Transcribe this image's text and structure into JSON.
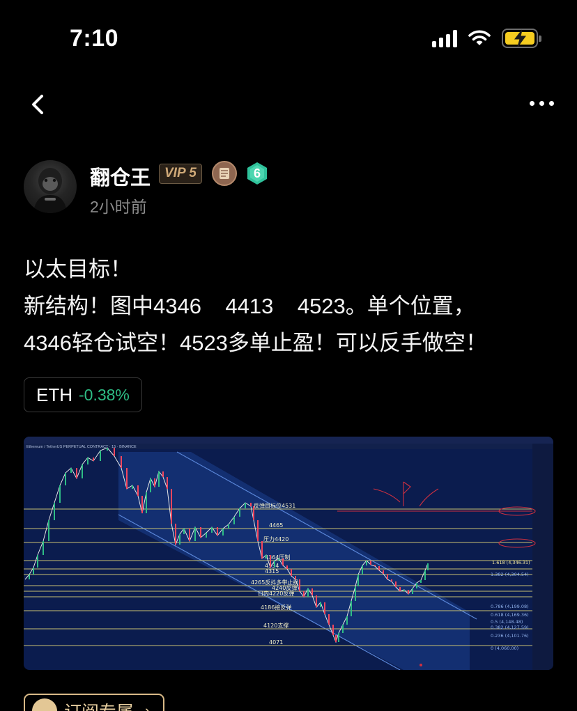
{
  "status_bar": {
    "time": "7:10"
  },
  "author": {
    "name": "翻仓王",
    "vip_label": "VIP 5",
    "level": "6",
    "posted": "2小时前"
  },
  "post": {
    "lines": [
      "以太目标！",
      "新结构！图中4346    4413    4523。单个位置，",
      "4346轻仓试空！4523多单止盈！可以反手做空！"
    ]
  },
  "ticker": {
    "symbol": "ETH",
    "change": "-0.38%",
    "change_color": "#2ebd85"
  },
  "chart_image": {
    "title_text": "Ethereum / TetherUS PERPETUAL CONTRACT · 15 · BINANCE",
    "level_labels": [
      "反弹目标位4531",
      "4465",
      "压力4420",
      "4364压制",
      "4334",
      "4315",
      "4265反抖多带止损",
      "4240反弹",
      "日内4220反弹",
      "4186接反弹",
      "4120支撑",
      "4071"
    ],
    "fib_labels": [
      "1.618 (4,346.31)",
      "1.382 (4,304.54)",
      "0.786 (4,199.08)",
      "0.618 (4,169.36)",
      "0.5 (4,148.48)",
      "0.382 (4,127.59)",
      "0.236 (4,101.76)",
      "0 (4,060.00)"
    ],
    "colors": {
      "background": "#0b1c4e",
      "level_line": "#c8c071",
      "channel": "#2e5bb7",
      "up_candle": "#2ebd85",
      "down_candle": "#f6465d"
    }
  },
  "subscribe": {
    "label": "订阅专属",
    "arrow": "›"
  }
}
